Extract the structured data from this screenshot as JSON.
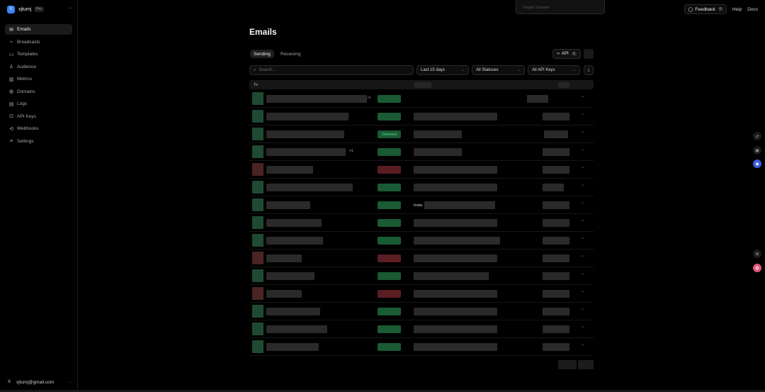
{
  "workspace": {
    "initial": "X",
    "name": "xjtumj",
    "plan": "Pro"
  },
  "nav": [
    {
      "label": "Emails",
      "icon": "mail-icon",
      "active": true
    },
    {
      "label": "Broadcasts",
      "icon": "broadcast-icon"
    },
    {
      "label": "Templates",
      "icon": "template-icon"
    },
    {
      "label": "Audience",
      "icon": "users-icon"
    },
    {
      "label": "Metrics",
      "icon": "chart-icon"
    },
    {
      "label": "Domains",
      "icon": "globe-icon"
    },
    {
      "label": "Logs",
      "icon": "logs-icon"
    },
    {
      "label": "API Keys",
      "icon": "lock-icon"
    },
    {
      "label": "Webhooks",
      "icon": "webhook-icon"
    },
    {
      "label": "Settings",
      "icon": "settings-icon"
    }
  ],
  "user": {
    "initial": "X",
    "email": "xjtumj@gmail.com",
    "more": "···"
  },
  "translate_popup": "Google Translate",
  "topbar": {
    "feedback": "Feedback",
    "feedback_key": "F",
    "help": "Help",
    "docs": "Docs"
  },
  "page": {
    "title": "Emails",
    "tabs": [
      "Sending",
      "Receiving"
    ],
    "api_button": "API",
    "api_key": "A",
    "search_placeholder": "Search...",
    "filters": {
      "date": "Last 15 days",
      "status": "All Statuses",
      "keys": "All API Keys"
    },
    "table_header": {
      "to": "To"
    },
    "rows": [
      {
        "status": "g",
        "extra": "",
        "marker": "›>"
      },
      {
        "status": "g",
        "extra": "",
        "marker": "."
      },
      {
        "status": "g",
        "badge": "Delivered"
      },
      {
        "status": "g",
        "extra": "+1"
      },
      {
        "status": "r"
      },
      {
        "status": "g"
      },
      {
        "status": "g",
        "subject_text": "Insta"
      },
      {
        "status": "g"
      },
      {
        "status": "g"
      },
      {
        "status": "r"
      },
      {
        "status": "g"
      },
      {
        "status": "r"
      },
      {
        "status": "g"
      },
      {
        "status": "g"
      },
      {
        "status": "g"
      }
    ],
    "row_more": "···"
  },
  "colors": {
    "accent": "#3b82f6",
    "delivered": "#1a5a34",
    "bounced": "#5a1e22"
  }
}
